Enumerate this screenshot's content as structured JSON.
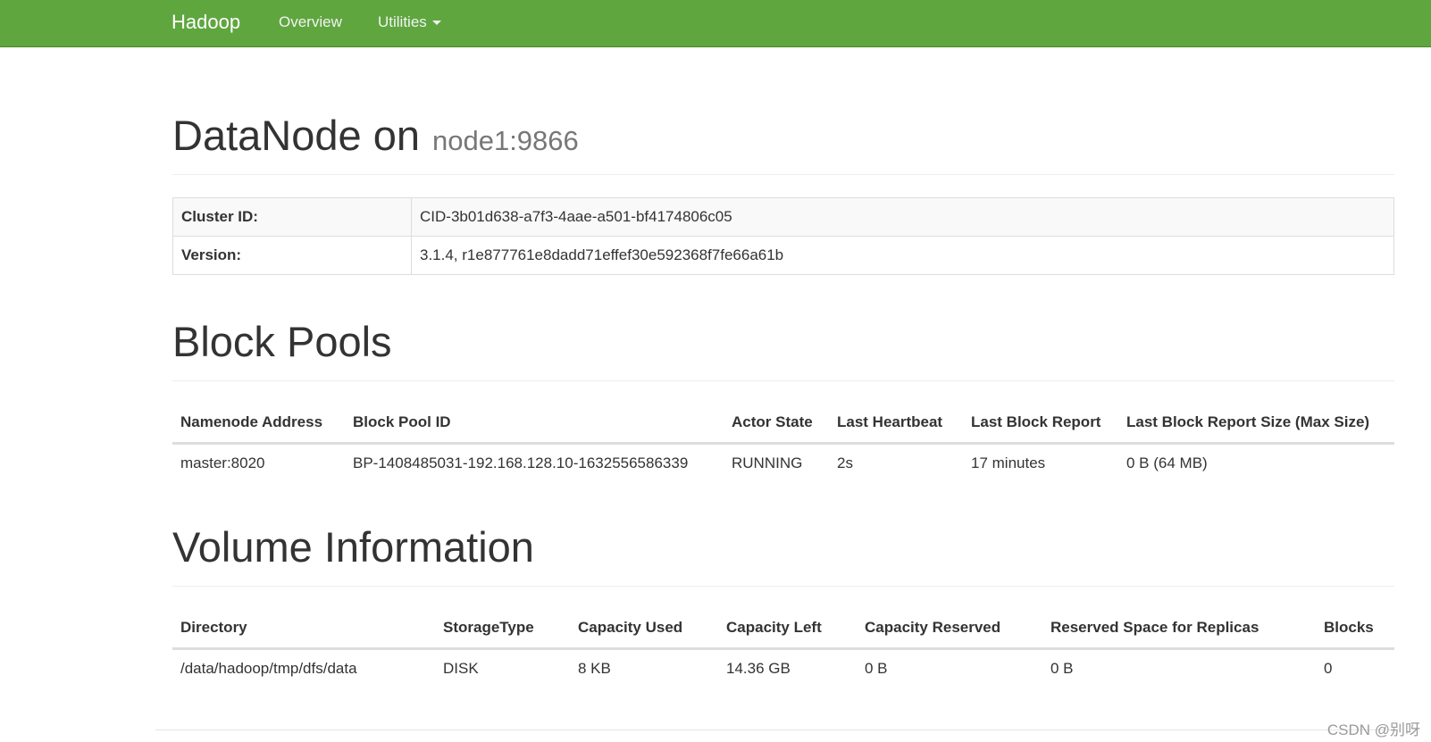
{
  "navbar": {
    "brand": "Hadoop",
    "links": [
      {
        "label": "Overview"
      },
      {
        "label": "Utilities"
      }
    ],
    "color": "#5fa63f"
  },
  "header": {
    "title": "DataNode on",
    "subtitle": "node1:9866"
  },
  "info": {
    "rows": [
      {
        "key": "Cluster ID:",
        "value": "CID-3b01d638-a7f3-4aae-a501-bf4174806c05"
      },
      {
        "key": "Version:",
        "value": "3.1.4, r1e877761e8dadd71effef30e592368f7fe66a61b"
      }
    ]
  },
  "block_pools": {
    "title": "Block Pools",
    "headers": [
      "Namenode Address",
      "Block Pool ID",
      "Actor State",
      "Last Heartbeat",
      "Last Block Report",
      "Last Block Report Size (Max Size)"
    ],
    "rows": [
      [
        "master:8020",
        "BP-1408485031-192.168.128.10-1632556586339",
        "RUNNING",
        "2s",
        "17 minutes",
        "0 B (64 MB)"
      ]
    ]
  },
  "volume_info": {
    "title": "Volume Information",
    "headers": [
      "Directory",
      "StorageType",
      "Capacity Used",
      "Capacity Left",
      "Capacity Reserved",
      "Reserved Space for Replicas",
      "Blocks"
    ],
    "rows": [
      [
        "/data/hadoop/tmp/dfs/data",
        "DISK",
        "8 KB",
        "14.36 GB",
        "0 B",
        "0 B",
        "0"
      ]
    ]
  },
  "watermark": "CSDN @别呀"
}
